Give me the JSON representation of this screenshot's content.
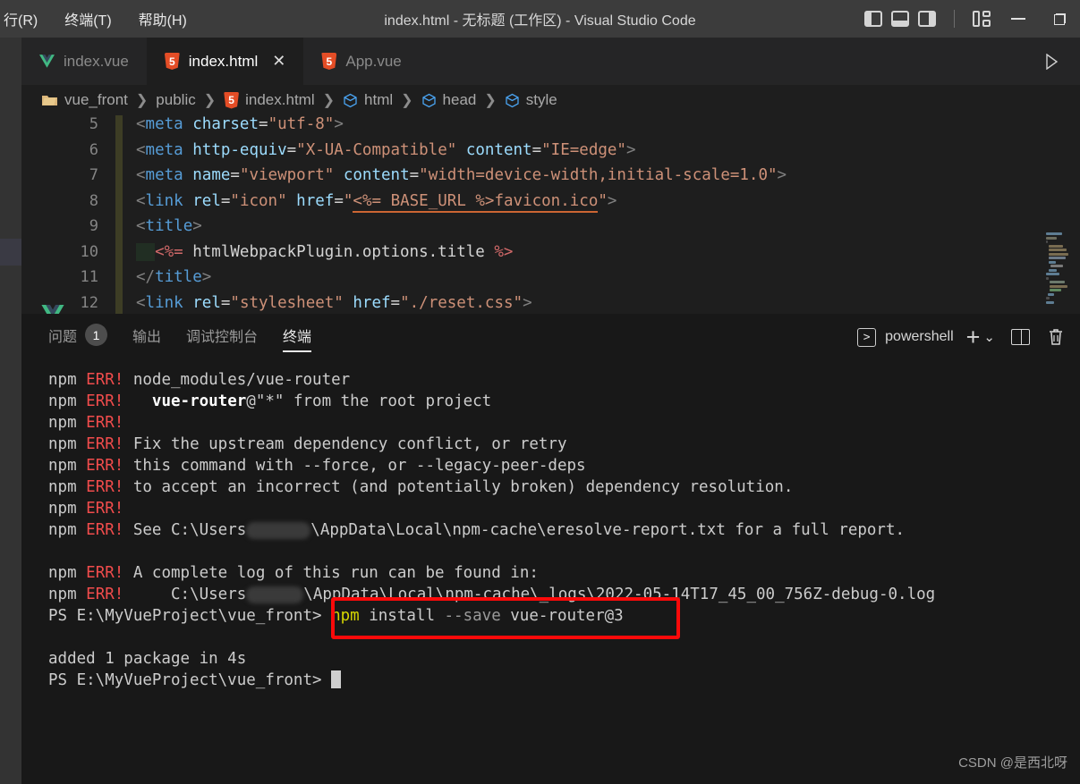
{
  "titlebar": {
    "menus": [
      "行(R)",
      "终端(T)",
      "帮助(H)"
    ],
    "window_title": "index.html - 无标题 (工作区) - Visual Studio Code",
    "icons": {
      "toggle_primary_sidebar": "layout-sidebar-left-icon",
      "toggle_panel": "layout-panel-icon",
      "toggle_secondary_sidebar": "layout-sidebar-right-icon",
      "customize_layout": "layout-customize-icon",
      "minimize": "minimize-icon",
      "restore": "restore-icon"
    }
  },
  "tabs": [
    {
      "label": "index.vue",
      "icon": "vue-icon",
      "active": false,
      "closable": false
    },
    {
      "label": "index.html",
      "icon": "html5-icon",
      "active": true,
      "closable": true,
      "close_label": "✕"
    },
    {
      "label": "App.vue",
      "icon": "html5-icon",
      "active": false,
      "closable": false
    }
  ],
  "editor_actions": {
    "run": "run-play-icon"
  },
  "breadcrumb": [
    {
      "label": "vue_front",
      "icon": "folder-icon"
    },
    {
      "label": "public",
      "icon": "none"
    },
    {
      "label": "index.html",
      "icon": "html5-icon"
    },
    {
      "label": "html",
      "icon": "symbol-cube-icon"
    },
    {
      "label": "head",
      "icon": "symbol-cube-icon"
    },
    {
      "label": "style",
      "icon": "symbol-cube-icon"
    }
  ],
  "breadcrumb_separator": "❯",
  "editor": {
    "language": "html",
    "lines": [
      {
        "num": "5",
        "text": "<meta charset=\"utf-8\">"
      },
      {
        "num": "6",
        "text": "<meta http-equiv=\"X-UA-Compatible\" content=\"IE=edge\">"
      },
      {
        "num": "7",
        "text": "<meta name=\"viewport\" content=\"width=device-width,initial-scale=1.0\">"
      },
      {
        "num": "8",
        "text": "<link rel=\"icon\" href=\"<%= BASE_URL %>favicon.ico\">"
      },
      {
        "num": "9",
        "text": "<title>"
      },
      {
        "num": "10",
        "text": "  <%= htmlWebpackPlugin.options.title %>"
      },
      {
        "num": "11",
        "text": "</title>"
      },
      {
        "num": "12",
        "text": "<link rel=\"stylesheet\" href=\"./reset.css\">"
      }
    ]
  },
  "panel": {
    "tabs": [
      {
        "label": "问题",
        "badge": "1",
        "active": false
      },
      {
        "label": "输出",
        "badge": "",
        "active": false
      },
      {
        "label": "调试控制台",
        "badge": "",
        "active": false
      },
      {
        "label": "终端",
        "badge": "",
        "active": true
      }
    ],
    "shell_name": "powershell",
    "shell_icon": "terminal-chevron-icon",
    "actions": {
      "new_terminal": "+",
      "dropdown": "⌄",
      "split_terminal": "split-icon",
      "kill_terminal": "trash-icon"
    }
  },
  "terminal": {
    "lines": [
      {
        "segs": [
          {
            "t": "npm ",
            "c": "plain"
          },
          {
            "t": "ERR! ",
            "c": "err"
          },
          {
            "t": "node_modules/vue-router",
            "c": "plain"
          }
        ]
      },
      {
        "segs": [
          {
            "t": "npm ",
            "c": "plain"
          },
          {
            "t": "ERR! ",
            "c": "err"
          },
          {
            "t": "  vue-router",
            "c": "bold"
          },
          {
            "t": "@\"*\" from the root project",
            "c": "plain"
          }
        ]
      },
      {
        "segs": [
          {
            "t": "npm ",
            "c": "plain"
          },
          {
            "t": "ERR!",
            "c": "err"
          }
        ]
      },
      {
        "segs": [
          {
            "t": "npm ",
            "c": "plain"
          },
          {
            "t": "ERR! ",
            "c": "err"
          },
          {
            "t": "Fix the upstream dependency conflict, or retry",
            "c": "plain"
          }
        ]
      },
      {
        "segs": [
          {
            "t": "npm ",
            "c": "plain"
          },
          {
            "t": "ERR! ",
            "c": "err"
          },
          {
            "t": "this command with --force, or --legacy-peer-deps",
            "c": "plain"
          }
        ]
      },
      {
        "segs": [
          {
            "t": "npm ",
            "c": "plain"
          },
          {
            "t": "ERR! ",
            "c": "err"
          },
          {
            "t": "to accept an incorrect (and potentially broken) dependency resolution.",
            "c": "plain"
          }
        ]
      },
      {
        "segs": [
          {
            "t": "npm ",
            "c": "plain"
          },
          {
            "t": "ERR!",
            "c": "err"
          }
        ]
      },
      {
        "segs": [
          {
            "t": "npm ",
            "c": "plain"
          },
          {
            "t": "ERR! ",
            "c": "err"
          },
          {
            "t": "See C:\\Users",
            "c": "plain"
          },
          {
            "t": "",
            "c": "redact",
            "w": 70
          },
          {
            "t": "\\AppData\\Local\\npm-cache\\eresolve-report.txt for a full report.",
            "c": "plain"
          }
        ]
      },
      {
        "segs": []
      },
      {
        "segs": [
          {
            "t": "npm ",
            "c": "plain"
          },
          {
            "t": "ERR! ",
            "c": "err"
          },
          {
            "t": "A complete log of this run can be found in:",
            "c": "plain"
          }
        ]
      },
      {
        "segs": [
          {
            "t": "npm ",
            "c": "plain"
          },
          {
            "t": "ERR! ",
            "c": "err"
          },
          {
            "t": "    C:\\Users",
            "c": "plain"
          },
          {
            "t": "",
            "c": "redact",
            "w": 62
          },
          {
            "t": "\\AppData\\Local\\npm-cache\\_logs\\2022-05-14T17_45_00_756Z-debug-0.log",
            "c": "plain"
          }
        ]
      },
      {
        "segs": [
          {
            "t": "PS E:\\MyVueProject\\vue_front> ",
            "c": "plain"
          },
          {
            "t": "npm",
            "c": "yellowish"
          },
          {
            "t": " install ",
            "c": "plain"
          },
          {
            "t": "--save",
            "c": "dimgray"
          },
          {
            "t": " vue-router@3",
            "c": "plain"
          }
        ]
      },
      {
        "segs": []
      },
      {
        "segs": [
          {
            "t": "added 1 package in 4s",
            "c": "plain"
          }
        ]
      },
      {
        "segs": [
          {
            "t": "PS E:\\MyVueProject\\vue_front> ",
            "c": "plain"
          },
          {
            "t": "",
            "c": "cursor"
          }
        ]
      }
    ],
    "highlight": {
      "color": "#fb0a0a",
      "target": "npm install --save vue-router@3"
    }
  },
  "watermark": "CSDN @是西北呀"
}
